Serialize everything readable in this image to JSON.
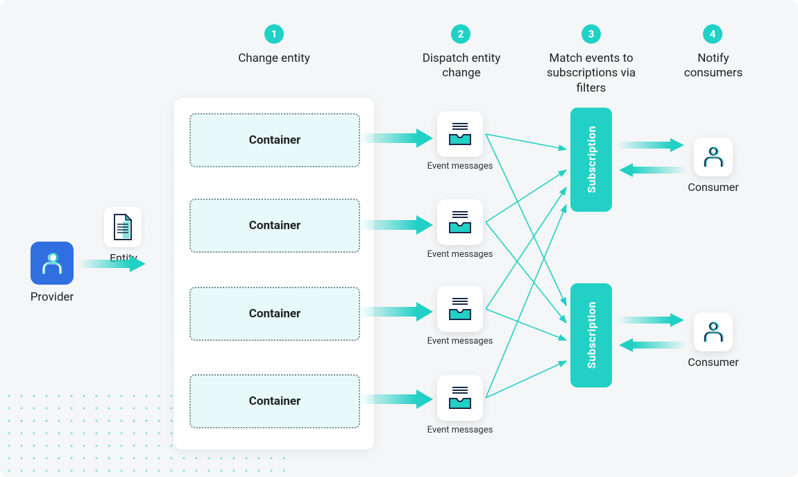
{
  "steps": [
    {
      "num": "1",
      "label": "Change entity"
    },
    {
      "num": "2",
      "label": "Dispatch entity\nchange"
    },
    {
      "num": "3",
      "label": "Match events to\nsubscriptions via\nfilters"
    },
    {
      "num": "4",
      "label": "Notify\nconsumers"
    }
  ],
  "provider": {
    "label": "Provider"
  },
  "entity": {
    "label": "Entity"
  },
  "containers": [
    {
      "label": "Container"
    },
    {
      "label": "Container"
    },
    {
      "label": "Container"
    },
    {
      "label": "Container"
    }
  ],
  "event_messages": [
    {
      "label": "Event messages"
    },
    {
      "label": "Event messages"
    },
    {
      "label": "Event messages"
    },
    {
      "label": "Event messages"
    }
  ],
  "subscriptions": [
    {
      "label": "Subscription"
    },
    {
      "label": "Subscription"
    }
  ],
  "consumers": [
    {
      "label": "Consumer"
    },
    {
      "label": "Consumer"
    }
  ],
  "colors": {
    "teal": "#23d0c5",
    "teal_light": "#e7faf9",
    "blue": "#2f6fe0",
    "navy": "#1a2a4a"
  }
}
